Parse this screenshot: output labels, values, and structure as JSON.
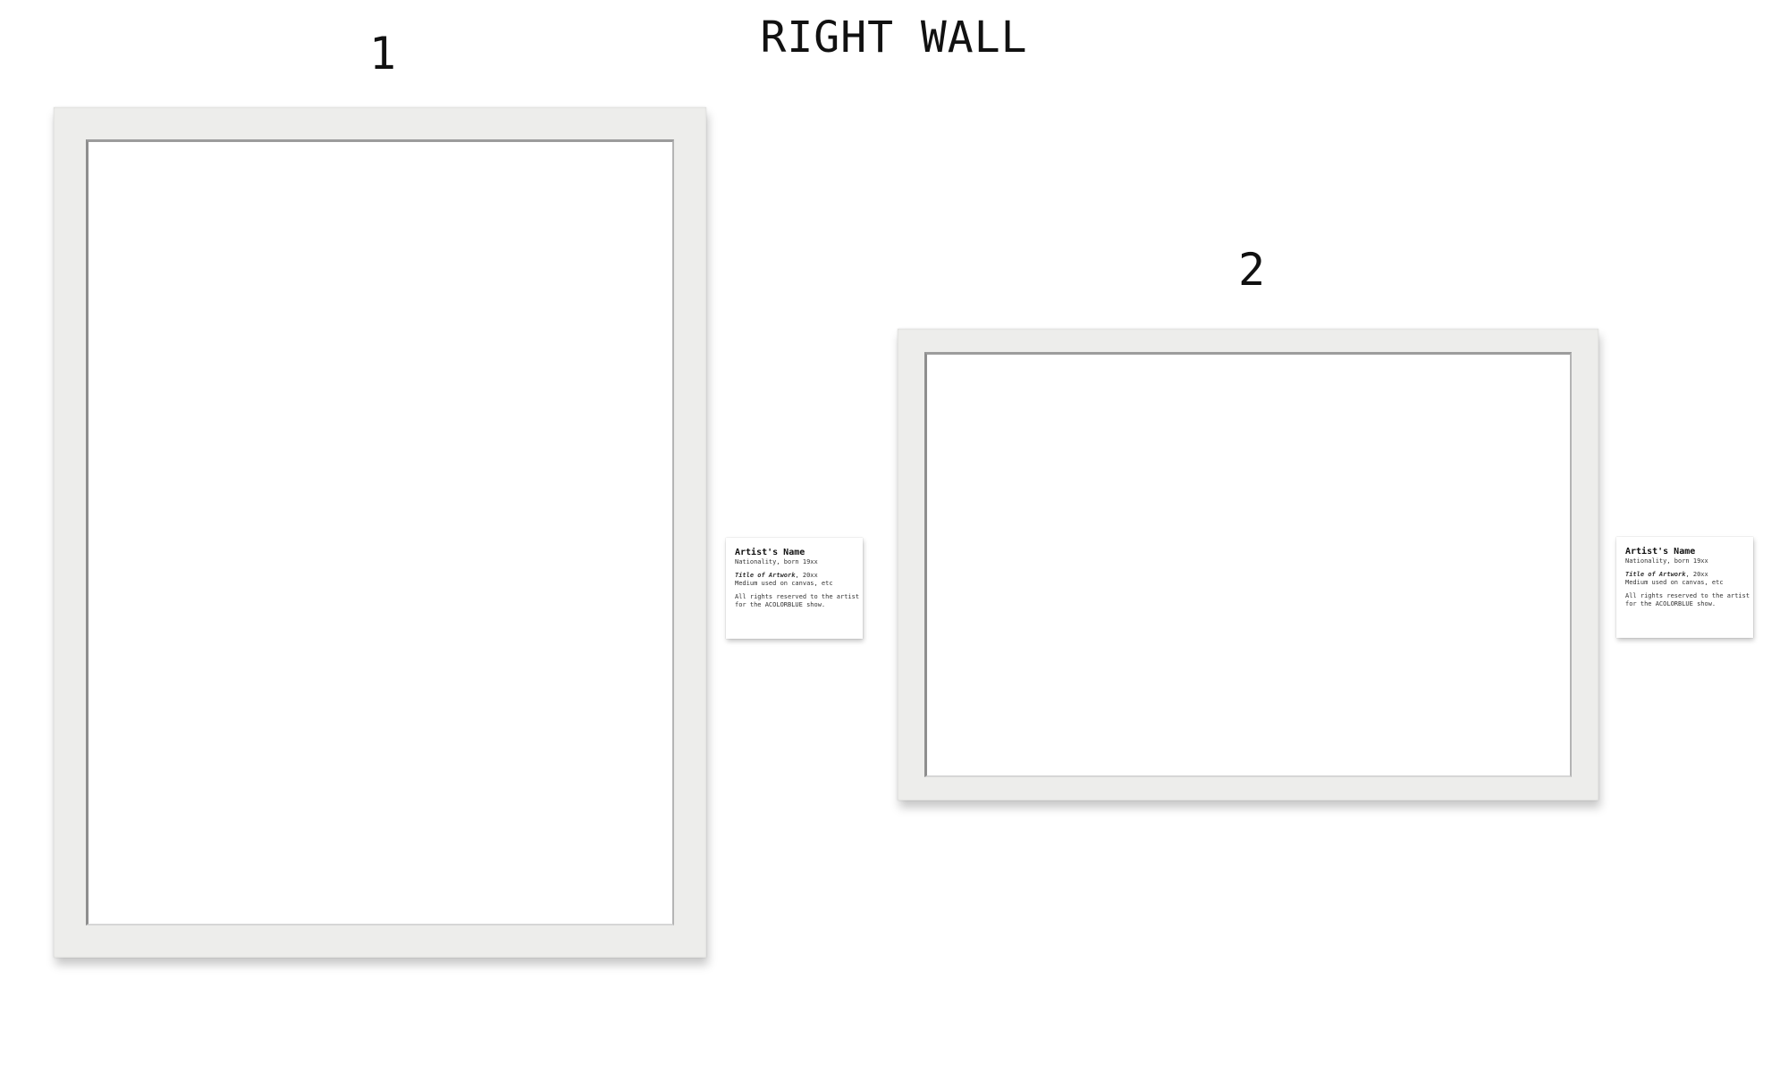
{
  "wall_title": "RIGHT WALL",
  "slots": [
    {
      "number": "1",
      "label": {
        "artist_name": "Artist's Name",
        "nationality": "Nationality, born 19xx",
        "artwork_title": "Title of Artwork",
        "artwork_year": ", 20xx",
        "medium": "Medium used on canvas, etc",
        "rights_line1": "All rights reserved to the artist",
        "rights_line2": "for the ACOLORBLUE show."
      }
    },
    {
      "number": "2",
      "label": {
        "artist_name": "Artist's Name",
        "nationality": "Nationality, born 19xx",
        "artwork_title": "Title of Artwork",
        "artwork_year": ", 20xx",
        "medium": "Medium used on canvas, etc",
        "rights_line1": "All rights reserved to the artist",
        "rights_line2": "for the ACOLORBLUE show."
      }
    }
  ],
  "colors": {
    "frame": "#ededeb",
    "mat": "#ffffff",
    "text": "#111111"
  }
}
